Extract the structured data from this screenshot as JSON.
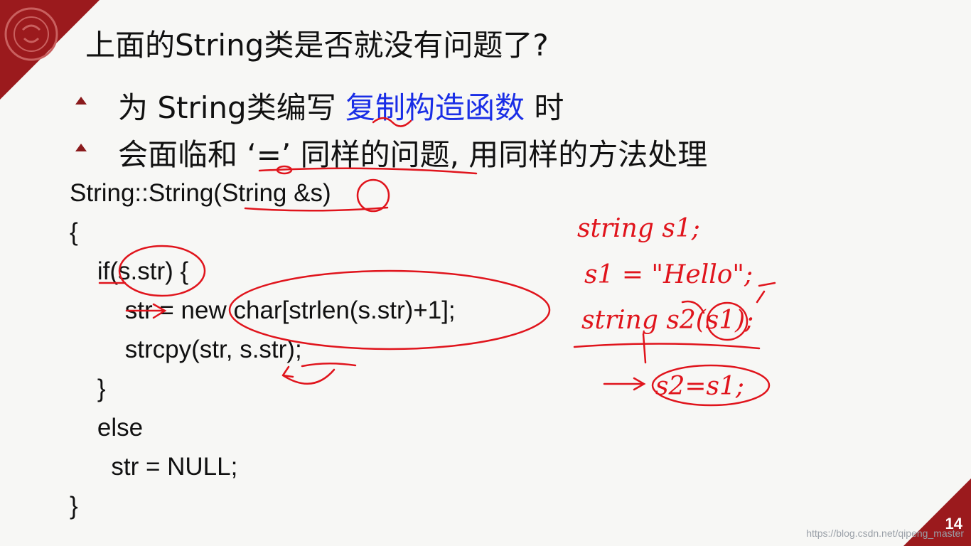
{
  "slide": {
    "title": "上面的String类是否就没有问题了?",
    "page_number": "14",
    "watermark": "https://blog.csdn.net/qipeng_master",
    "bullets": [
      {
        "before": "为 String类编写 ",
        "highlight": "复制构造函数",
        "after": " 时"
      },
      {
        "text": "会面临和 ‘=’ 同样的问题, 用同样的方法处理"
      }
    ],
    "code_lines": [
      "String::String(String &s)",
      "{",
      "    if(s.str) {",
      "        str = new char[strlen(s.str)+1];",
      "        strcpy(str, s.str);",
      "    }",
      "    else",
      "      str = NULL;",
      "}"
    ],
    "handwriting": {
      "line1": "string s1;",
      "line2": "s1 = \"Hello\";",
      "line3": "string s2(s1);",
      "line4": "s2=s1;"
    }
  },
  "colors": {
    "accent": "#9b1a1d",
    "highlight": "#1a2ee6",
    "ink": "#e0141c"
  },
  "icons": {
    "seal": "university-seal-icon",
    "bullet": "triangle-bullet-icon"
  }
}
